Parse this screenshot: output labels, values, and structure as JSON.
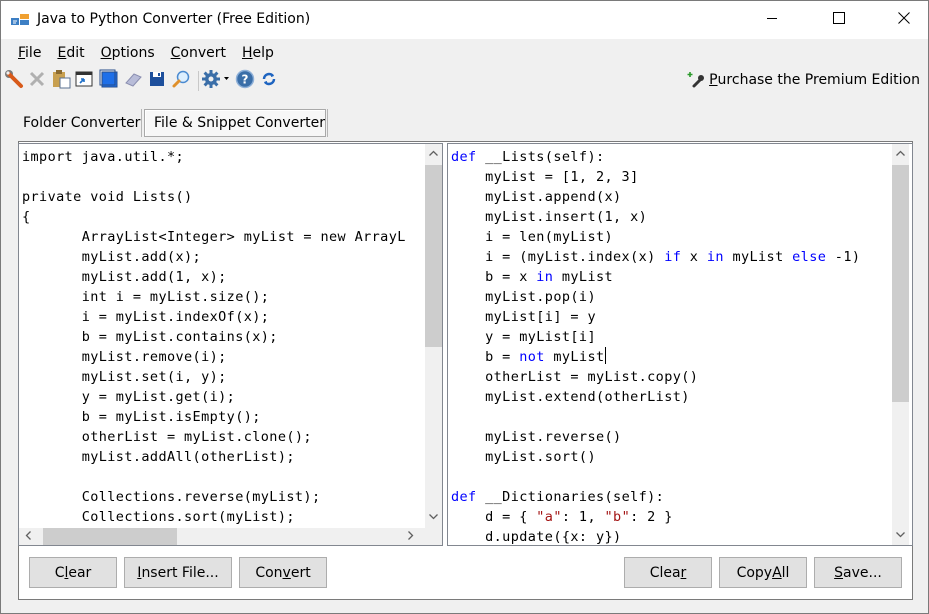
{
  "window": {
    "title": "Java to Python Converter (Free Edition)",
    "app_icon": "converter-app-icon",
    "controls": {
      "minimize": "minimize-icon",
      "maximize": "maximize-icon",
      "close": "close-icon"
    }
  },
  "menu": [
    {
      "label": "File",
      "mnemonic": "F",
      "rest": "ile"
    },
    {
      "label": "Edit",
      "mnemonic": "E",
      "rest": "dit"
    },
    {
      "label": "Options",
      "mnemonic": "O",
      "rest": "ptions"
    },
    {
      "label": "Convert",
      "mnemonic": "C",
      "rest": "onvert"
    },
    {
      "label": "Help",
      "mnemonic": "H",
      "rest": "elp"
    }
  ],
  "toolbar": {
    "icons": [
      "wrench-icon",
      "delete-x-icon",
      "paste-icon",
      "open-window-icon",
      "select-all-icon",
      "eraser-icon",
      "save-disk-icon",
      "find-magnifier-icon",
      "settings-gear-dropdown-icon",
      "help-icon",
      "refresh-icon"
    ],
    "purchase": {
      "label": "Purchase the Premium Edition",
      "mnemonic": "P",
      "rest": "urchase the Premium Edition",
      "icon": "purchase-wrench-plus-icon"
    }
  },
  "tabs": [
    {
      "label": "Folder Converter",
      "active": false
    },
    {
      "label": "File & Snippet Converter",
      "active": true
    }
  ],
  "java_source": {
    "lines": [
      "import java.util.*;",
      "",
      "private void Lists()",
      "{",
      "       ArrayList<Integer> myList = new ArrayL",
      "       myList.add(x);",
      "       myList.add(1, x);",
      "       int i = myList.size();",
      "       i = myList.indexOf(x);",
      "       b = myList.contains(x);",
      "       myList.remove(i);",
      "       myList.set(i, y);",
      "       y = myList.get(i);",
      "       b = myList.isEmpty();",
      "       otherList = myList.clone();",
      "       myList.addAll(otherList);",
      "",
      "       Collections.reverse(myList);",
      "       Collections.sort(myList);"
    ]
  },
  "python_output": {
    "lines": [
      [
        {
          "t": "def",
          "k": "kw"
        },
        {
          "t": " __Lists(self):"
        }
      ],
      [
        {
          "t": "    myList = [1, 2, 3]"
        }
      ],
      [
        {
          "t": "    myList.append(x)"
        }
      ],
      [
        {
          "t": "    myList.insert(1, x)"
        }
      ],
      [
        {
          "t": "    i = len(myList)"
        }
      ],
      [
        {
          "t": "    i = (myList.index(x) "
        },
        {
          "t": "if",
          "k": "kw"
        },
        {
          "t": " x "
        },
        {
          "t": "in",
          "k": "kw"
        },
        {
          "t": " myList "
        },
        {
          "t": "else",
          "k": "kw"
        },
        {
          "t": " -1)"
        }
      ],
      [
        {
          "t": "    b = x "
        },
        {
          "t": "in",
          "k": "kw"
        },
        {
          "t": " myList"
        }
      ],
      [
        {
          "t": "    myList.pop(i)"
        }
      ],
      [
        {
          "t": "    myList[i] = y"
        }
      ],
      [
        {
          "t": "    y = myList[i]"
        }
      ],
      [
        {
          "t": "    b = "
        },
        {
          "t": "not",
          "k": "kw"
        },
        {
          "t": " myList"
        },
        {
          "t": "",
          "k": "caret"
        }
      ],
      [
        {
          "t": "    otherList = myList.copy()"
        }
      ],
      [
        {
          "t": "    myList.extend(otherList)"
        }
      ],
      [
        {
          "t": ""
        }
      ],
      [
        {
          "t": "    myList.reverse()"
        }
      ],
      [
        {
          "t": "    myList.sort()"
        }
      ],
      [
        {
          "t": ""
        }
      ],
      [
        {
          "t": "def",
          "k": "kw"
        },
        {
          "t": " __Dictionaries(self):"
        }
      ],
      [
        {
          "t": "    d = { "
        },
        {
          "t": "\"a\"",
          "k": "str"
        },
        {
          "t": ": 1, "
        },
        {
          "t": "\"b\"",
          "k": "str"
        },
        {
          "t": ": 2 }"
        }
      ],
      [
        {
          "t": "    d.update({x: y})"
        }
      ]
    ]
  },
  "buttons_left": [
    {
      "label": "Clear",
      "pre": "C",
      "mn": "l",
      "post": "ear"
    },
    {
      "label": "Insert File...",
      "pre": "",
      "mn": "I",
      "post": "nsert File..."
    },
    {
      "label": "Convert",
      "pre": "Con",
      "mn": "v",
      "post": "ert"
    }
  ],
  "buttons_right": [
    {
      "label": "Clear",
      "pre": "Clea",
      "mn": "r",
      "post": ""
    },
    {
      "label": "Copy All",
      "pre": "Copy ",
      "mn": "A",
      "post": "ll"
    },
    {
      "label": "Save...",
      "pre": "",
      "mn": "S",
      "post": "ave..."
    }
  ],
  "colors": {
    "keyword": "#0000ff",
    "string": "#a31515",
    "button_face": "#e1e1e1",
    "scroll_thumb": "#cdcdcd"
  }
}
